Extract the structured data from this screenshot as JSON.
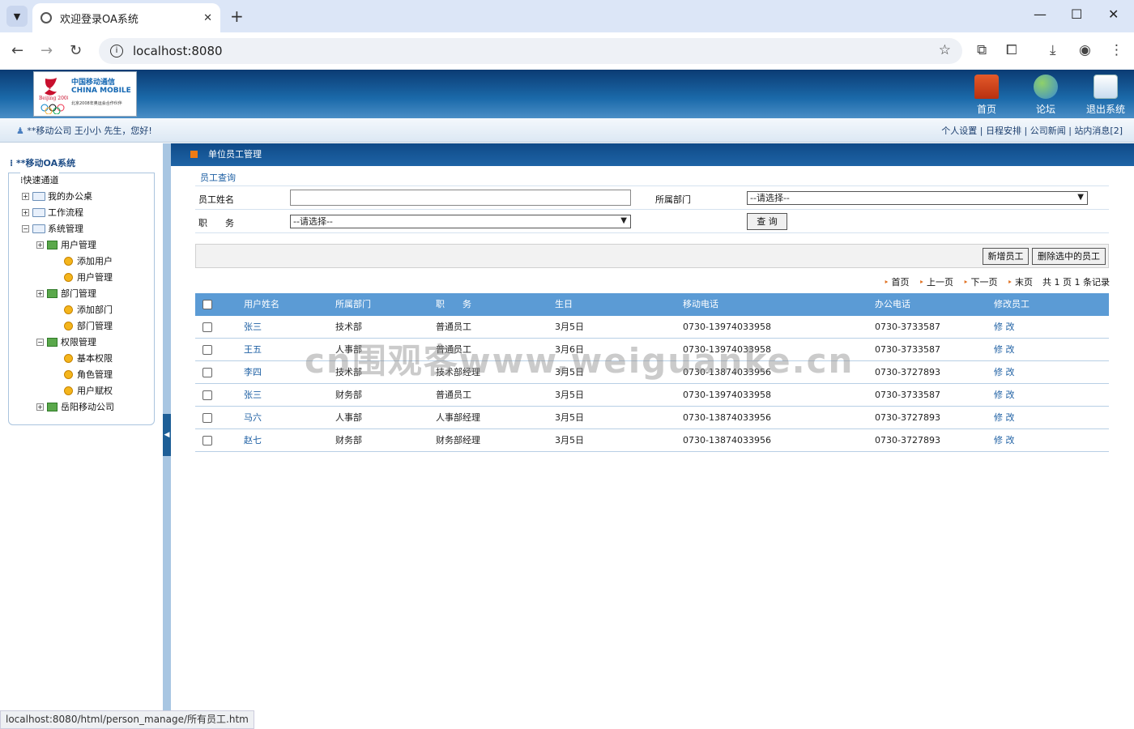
{
  "browser": {
    "tab_title": "欢迎登录OA系统",
    "url": "localhost:8080",
    "status_url": "localhost:8080/html/person_manage/所有员工.htm"
  },
  "header": {
    "logo_text_1": "中国移动通信",
    "logo_text_2": "CHINA MOBILE",
    "logo_sub": "北京2008年奥运会合作伙伴",
    "nav": [
      {
        "label": "首页",
        "icon": "home-icon"
      },
      {
        "label": "论坛",
        "icon": "forum-icon"
      },
      {
        "label": "退出系统",
        "icon": "exit-icon"
      }
    ]
  },
  "userbar": {
    "greeting": "**移动公司 王小小 先生，您好!",
    "links": [
      "个人设置",
      "日程安排",
      "公司新闻",
      "站内消息[2]"
    ]
  },
  "sidebar": {
    "title": "**移动OA系统",
    "tree": [
      {
        "label": "快速通道",
        "level": 0,
        "kind": "root"
      },
      {
        "label": "我的办公桌",
        "level": 1,
        "kind": "folder",
        "toggle": "+"
      },
      {
        "label": "工作流程",
        "level": 1,
        "kind": "folder",
        "toggle": "+"
      },
      {
        "label": "系统管理",
        "level": 1,
        "kind": "folder",
        "toggle": "-"
      },
      {
        "label": "用户管理",
        "level": 2,
        "kind": "group",
        "toggle": "+"
      },
      {
        "label": "添加用户",
        "level": 3,
        "kind": "leaf"
      },
      {
        "label": "用户管理",
        "level": 3,
        "kind": "leaf"
      },
      {
        "label": "部门管理",
        "level": 2,
        "kind": "group",
        "toggle": "+"
      },
      {
        "label": "添加部门",
        "level": 3,
        "kind": "leaf"
      },
      {
        "label": "部门管理",
        "level": 3,
        "kind": "leaf"
      },
      {
        "label": "权限管理",
        "level": 2,
        "kind": "group",
        "toggle": "-"
      },
      {
        "label": "基本权限",
        "level": 3,
        "kind": "leaf"
      },
      {
        "label": "角色管理",
        "level": 3,
        "kind": "leaf"
      },
      {
        "label": "用户赋权",
        "level": 3,
        "kind": "leaf"
      },
      {
        "label": "岳阳移动公司",
        "level": 2,
        "kind": "group",
        "toggle": "+"
      }
    ]
  },
  "content": {
    "breadcrumb": "单位员工管理",
    "query": {
      "title": "员工查询",
      "name_label": "员工姓名",
      "name_value": "",
      "dept_label": "所属部门",
      "dept_value": "--请选择--",
      "post_label": "职　　务",
      "post_value": "--请选择--",
      "search_button": "查 询"
    },
    "toolbar": {
      "add_button": "新增员工",
      "delete_button": "删除选中的员工"
    },
    "pager": {
      "first": "首页",
      "prev": "上一页",
      "next": "下一页",
      "last": "末页",
      "summary": "共 1 页 1 条记录"
    },
    "table": {
      "headers": [
        "用户姓名",
        "所属部门",
        "职　　务",
        "生日",
        "移动电话",
        "办公电话",
        "修改员工"
      ],
      "rows": [
        {
          "name": "张三",
          "dept": "技术部",
          "post": "普通员工",
          "birthday": "3月5日",
          "mobile": "0730-13974033958",
          "office": "0730-3733587",
          "action": "修 改"
        },
        {
          "name": "王五",
          "dept": "人事部",
          "post": "普通员工",
          "birthday": "3月6日",
          "mobile": "0730-13974033958",
          "office": "0730-3733587",
          "action": "修 改"
        },
        {
          "name": "李四",
          "dept": "技术部",
          "post": "技术部经理",
          "birthday": "3月5日",
          "mobile": "0730-13874033956",
          "office": "0730-3727893",
          "action": "修 改"
        },
        {
          "name": "张三",
          "dept": "财务部",
          "post": "普通员工",
          "birthday": "3月5日",
          "mobile": "0730-13974033958",
          "office": "0730-3733587",
          "action": "修 改"
        },
        {
          "name": "马六",
          "dept": "人事部",
          "post": "人事部经理",
          "birthday": "3月5日",
          "mobile": "0730-13874033956",
          "office": "0730-3727893",
          "action": "修 改"
        },
        {
          "name": "赵七",
          "dept": "财务部",
          "post": "财务部经理",
          "birthday": "3月5日",
          "mobile": "0730-13874033956",
          "office": "0730-3727893",
          "action": "修 改"
        }
      ]
    }
  },
  "watermark": "cn围观客www.weiguanke.cn"
}
